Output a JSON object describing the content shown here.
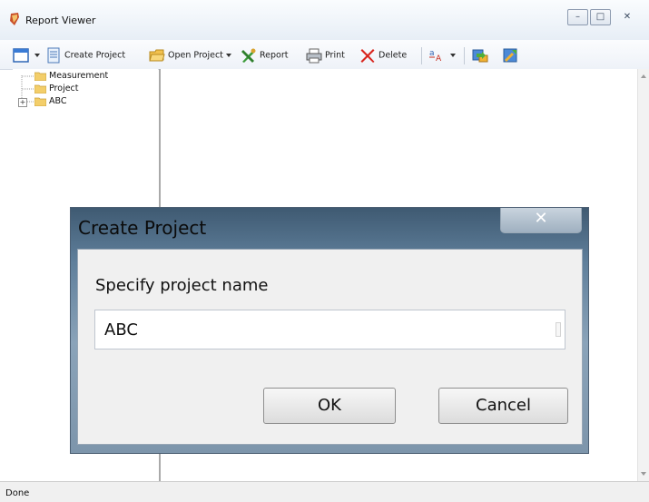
{
  "window": {
    "title": "Report Viewer",
    "controls": {
      "minimize": "–",
      "maximize": "□",
      "close": "✕"
    }
  },
  "toolbar": {
    "items": [
      {
        "label": "Create Project",
        "icon": "document-icon"
      },
      {
        "label": "Open Project",
        "icon": "folder-open-icon"
      },
      {
        "label": "Report",
        "icon": "report-wrench-icon"
      },
      {
        "label": "Print",
        "icon": "printer-icon"
      },
      {
        "label": "Delete",
        "icon": "delete-x-icon"
      }
    ]
  },
  "tree": {
    "items": [
      {
        "label": "Measurement"
      },
      {
        "label": "Project"
      },
      {
        "label": "ABC",
        "expander": "+"
      }
    ]
  },
  "dialog": {
    "title": "Create Project",
    "close": "✕",
    "prompt": "Specify project name",
    "input_value": "ABC",
    "ok_label": "OK",
    "cancel_label": "Cancel"
  },
  "status": {
    "text": "Done"
  },
  "colors": {
    "accent": "#e8a93a",
    "dialog_frame": "#5f7f9b"
  }
}
